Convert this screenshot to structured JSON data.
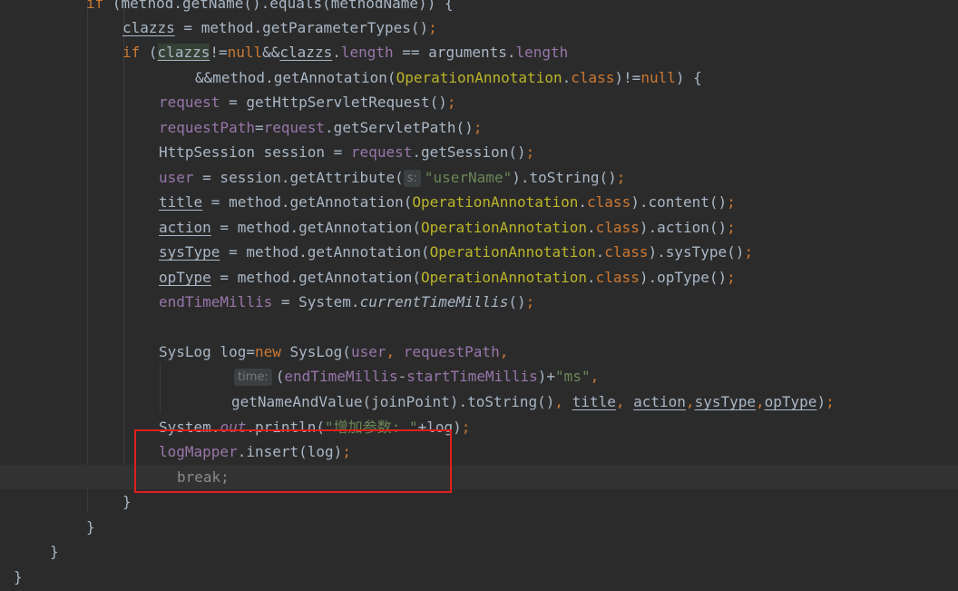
{
  "editor": {
    "lines": [
      {
        "id": "l0",
        "tokens": [
          {
            "c": "t-kw",
            "t": "if "
          },
          {
            "c": "t-plain",
            "t": "(method.getName().equals(methodName)) {"
          }
        ]
      },
      {
        "id": "l1",
        "tokens": [
          {
            "c": "t-plain u",
            "t": "clazzs"
          },
          {
            "c": "t-plain",
            "t": " = method.getParameterTypes()"
          },
          {
            "c": "t-kw",
            "t": ";"
          }
        ]
      },
      {
        "id": "l2",
        "tokens": [
          {
            "c": "t-kw",
            "t": "if "
          },
          {
            "c": "t-plain",
            "t": "("
          },
          {
            "c": "t-plain u hl",
            "t": "clazzs"
          },
          {
            "c": "t-plain",
            "t": "!="
          },
          {
            "c": "t-kw",
            "t": "null"
          },
          {
            "c": "t-plain",
            "t": "&&"
          },
          {
            "c": "t-plain u",
            "t": "clazzs"
          },
          {
            "c": "t-plain",
            "t": "."
          },
          {
            "c": "t-field",
            "t": "length"
          },
          {
            "c": "t-plain",
            "t": " == arguments."
          },
          {
            "c": "t-field",
            "t": "length"
          }
        ]
      },
      {
        "id": "l3",
        "tokens": [
          {
            "c": "t-plain",
            "t": "&&method.getAnnotation("
          },
          {
            "c": "t-ann",
            "t": "OperationAnnotation"
          },
          {
            "c": "t-plain",
            "t": "."
          },
          {
            "c": "t-kw",
            "t": "class"
          },
          {
            "c": "t-plain",
            "t": ")!="
          },
          {
            "c": "t-kw",
            "t": "null"
          },
          {
            "c": "t-plain",
            "t": ") {"
          }
        ]
      },
      {
        "id": "l4",
        "tokens": [
          {
            "c": "t-field",
            "t": "request"
          },
          {
            "c": "t-plain",
            "t": " = getHttpServletRequest()"
          },
          {
            "c": "t-kw",
            "t": ";"
          }
        ]
      },
      {
        "id": "l5",
        "tokens": [
          {
            "c": "t-field",
            "t": "requestPath"
          },
          {
            "c": "t-plain",
            "t": "="
          },
          {
            "c": "t-field",
            "t": "request"
          },
          {
            "c": "t-plain",
            "t": ".getServletPath()"
          },
          {
            "c": "t-kw",
            "t": ";"
          }
        ]
      },
      {
        "id": "l6",
        "tokens": [
          {
            "c": "t-plain",
            "t": "HttpSession session = "
          },
          {
            "c": "t-field",
            "t": "request"
          },
          {
            "c": "t-plain",
            "t": ".getSession()"
          },
          {
            "c": "t-kw",
            "t": ";"
          }
        ]
      },
      {
        "id": "l7",
        "tokens": [
          {
            "c": "t-field",
            "t": "user"
          },
          {
            "c": "t-plain",
            "t": " = session.getAttribute("
          },
          {
            "c": "hint",
            "t": "s:"
          },
          {
            "c": "t-str",
            "t": "\"userName\""
          },
          {
            "c": "t-plain",
            "t": ").toString()"
          },
          {
            "c": "t-kw",
            "t": ";"
          }
        ]
      },
      {
        "id": "l8",
        "tokens": [
          {
            "c": "t-plain u",
            "t": "title"
          },
          {
            "c": "t-plain",
            "t": " = method.getAnnotation("
          },
          {
            "c": "t-ann",
            "t": "OperationAnnotation"
          },
          {
            "c": "t-plain",
            "t": "."
          },
          {
            "c": "t-kw",
            "t": "class"
          },
          {
            "c": "t-plain",
            "t": ").content()"
          },
          {
            "c": "t-kw",
            "t": ";"
          }
        ]
      },
      {
        "id": "l9",
        "tokens": [
          {
            "c": "t-plain u",
            "t": "action"
          },
          {
            "c": "t-plain",
            "t": " = method.getAnnotation("
          },
          {
            "c": "t-ann",
            "t": "OperationAnnotation"
          },
          {
            "c": "t-plain",
            "t": "."
          },
          {
            "c": "t-kw",
            "t": "class"
          },
          {
            "c": "t-plain",
            "t": ").action()"
          },
          {
            "c": "t-kw",
            "t": ";"
          }
        ]
      },
      {
        "id": "l10",
        "tokens": [
          {
            "c": "t-plain u",
            "t": "sysType"
          },
          {
            "c": "t-plain",
            "t": " = method.getAnnotation("
          },
          {
            "c": "t-ann",
            "t": "OperationAnnotation"
          },
          {
            "c": "t-plain",
            "t": "."
          },
          {
            "c": "t-kw",
            "t": "class"
          },
          {
            "c": "t-plain",
            "t": ").sysType()"
          },
          {
            "c": "t-kw",
            "t": ";"
          }
        ]
      },
      {
        "id": "l11",
        "tokens": [
          {
            "c": "t-plain u",
            "t": "opType"
          },
          {
            "c": "t-plain",
            "t": " = method.getAnnotation("
          },
          {
            "c": "t-ann",
            "t": "OperationAnnotation"
          },
          {
            "c": "t-plain",
            "t": "."
          },
          {
            "c": "t-kw",
            "t": "class"
          },
          {
            "c": "t-plain",
            "t": ").opType()"
          },
          {
            "c": "t-kw",
            "t": ";"
          }
        ]
      },
      {
        "id": "l12",
        "tokens": [
          {
            "c": "t-field",
            "t": "endTimeMillis"
          },
          {
            "c": "t-plain",
            "t": " = System."
          },
          {
            "c": "t-plain t-italic",
            "t": "currentTimeMillis"
          },
          {
            "c": "t-plain",
            "t": "()"
          },
          {
            "c": "t-kw",
            "t": ";"
          }
        ]
      },
      {
        "id": "l13",
        "tokens": []
      },
      {
        "id": "l14",
        "tokens": [
          {
            "c": "t-plain",
            "t": "SysLog log="
          },
          {
            "c": "t-kw",
            "t": "new "
          },
          {
            "c": "t-plain",
            "t": "SysLog("
          },
          {
            "c": "t-field",
            "t": "user"
          },
          {
            "c": "t-kw",
            "t": ", "
          },
          {
            "c": "t-field",
            "t": "requestPath"
          },
          {
            "c": "t-kw",
            "t": ","
          }
        ]
      },
      {
        "id": "l15",
        "tokens": [
          {
            "c": "hint",
            "t": "time:"
          },
          {
            "c": "t-plain",
            "t": "("
          },
          {
            "c": "t-field",
            "t": "endTimeMillis"
          },
          {
            "c": "t-plain",
            "t": "-"
          },
          {
            "c": "t-field",
            "t": "startTimeMillis"
          },
          {
            "c": "t-plain",
            "t": ")+"
          },
          {
            "c": "t-str",
            "t": "\"ms\""
          },
          {
            "c": "t-kw",
            "t": ","
          }
        ]
      },
      {
        "id": "l16",
        "tokens": [
          {
            "c": "t-plain",
            "t": "getNameAndValue(joinPoint).toString()"
          },
          {
            "c": "t-kw",
            "t": ", "
          },
          {
            "c": "t-plain u",
            "t": "title"
          },
          {
            "c": "t-kw",
            "t": ", "
          },
          {
            "c": "t-plain u",
            "t": "action"
          },
          {
            "c": "t-kw",
            "t": ","
          },
          {
            "c": "t-plain u",
            "t": "sysType"
          },
          {
            "c": "t-kw",
            "t": ","
          },
          {
            "c": "t-plain u",
            "t": "opType"
          },
          {
            "c": "t-plain",
            "t": ")"
          },
          {
            "c": "t-kw",
            "t": ";"
          }
        ]
      },
      {
        "id": "l17",
        "tokens": [
          {
            "c": "t-plain",
            "t": "System."
          },
          {
            "c": "t-fieldi",
            "t": "out"
          },
          {
            "c": "t-plain",
            "t": ".println("
          },
          {
            "c": "t-str",
            "t": "\"增加参数: \""
          },
          {
            "c": "t-plain",
            "t": "+log)"
          },
          {
            "c": "t-kw",
            "t": ";"
          }
        ]
      },
      {
        "id": "l18",
        "tokens": [
          {
            "c": "t-field",
            "t": "logMapper"
          },
          {
            "c": "t-plain",
            "t": ".insert(log)"
          },
          {
            "c": "t-kw",
            "t": ";"
          }
        ]
      },
      {
        "id": "l19",
        "tokens": [
          {
            "c": "dim",
            "t": "break;"
          }
        ]
      },
      {
        "id": "l20",
        "tokens": [
          {
            "c": "t-plain",
            "t": "}"
          }
        ]
      },
      {
        "id": "l21",
        "tokens": [
          {
            "c": "t-plain",
            "t": "}"
          }
        ]
      },
      {
        "id": "l22",
        "tokens": [
          {
            "c": "t-plain",
            "t": "}"
          }
        ]
      },
      {
        "id": "l23",
        "tokens": [
          {
            "c": "t-plain",
            "t": "}"
          }
        ]
      }
    ]
  },
  "colors": {
    "background": "#2b2b2b",
    "keyword": "#cc7832",
    "field": "#9876aa",
    "annotation": "#bbb529",
    "string": "#6a8759",
    "default": "#a9b7c6",
    "highlight_box": "#e0201c"
  }
}
